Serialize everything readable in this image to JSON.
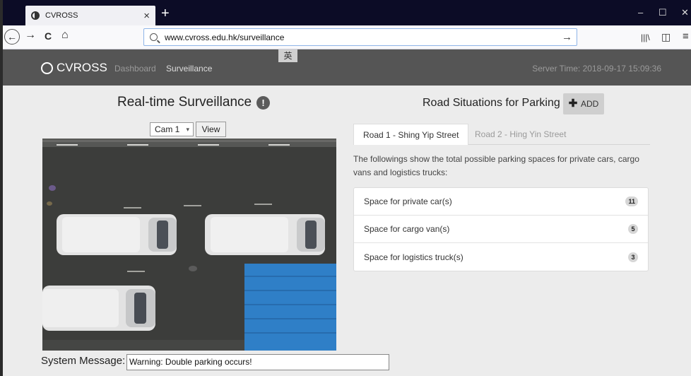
{
  "browser": {
    "tab_title": "CVROSS",
    "tab_close": "×",
    "new_tab": "+",
    "url": "www.cvross.edu.hk/surveillance",
    "url_go": "→",
    "win_minimize": "–",
    "win_maximize": "☐",
    "win_close": "✕",
    "back": "←",
    "forward": "→",
    "reload": "C",
    "home": "⌂",
    "library": "|||\\",
    "sidebar": "◫",
    "menu": "≡"
  },
  "ime_indicator": "英",
  "header": {
    "brand": "CVROSS",
    "nav": [
      "Dashboard",
      "Surveillance"
    ],
    "server_time": "Server Time: 2018-09-17 15:09:36"
  },
  "surveillance": {
    "title": "Real-time Surveillance",
    "info_badge": "!",
    "camera_selected": "Cam 1",
    "view_label": "View",
    "system_message_label": "System Message:",
    "system_message": "Warning: Double parking occurs!"
  },
  "parking": {
    "title": "Road Situations for Parking",
    "add_label": "ADD",
    "tabs": [
      "Road 1 - Shing Yip Street",
      "Road 2 - Hing Yin Street"
    ],
    "description": "The followings show the total possible parking spaces for private cars, cargo vans and logistics trucks:",
    "items": [
      {
        "label": "Space for private car(s)",
        "count": "11"
      },
      {
        "label": "Space for cargo van(s)",
        "count": "5"
      },
      {
        "label": "Space for logistics truck(s)",
        "count": "3"
      }
    ]
  }
}
